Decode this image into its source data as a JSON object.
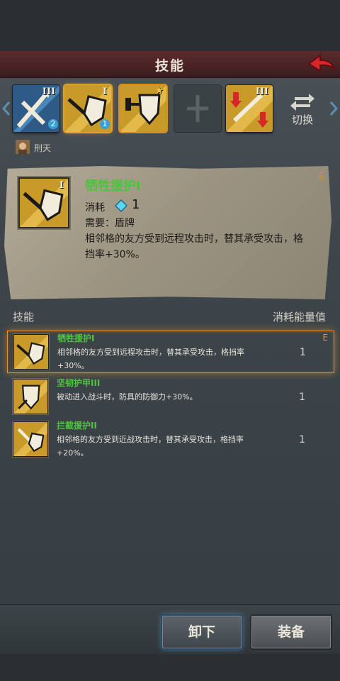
{
  "header": {
    "title": "技能"
  },
  "skill_slots": [
    {
      "tier": "III",
      "badge": "2",
      "style": "blue"
    },
    {
      "tier": "I",
      "badge": "1",
      "style": "gold",
      "selected": true
    },
    {
      "tier": "",
      "badge": "★",
      "style": "gold-shield"
    },
    {
      "tier": "",
      "badge": "",
      "style": "empty"
    },
    {
      "tier": "III",
      "badge": "",
      "style": "gold-arrows"
    }
  ],
  "switch": {
    "label": "切换"
  },
  "hero": {
    "name": "刑天"
  },
  "detail": {
    "title": "牺牲援护I",
    "grade": "E",
    "tier": "I",
    "cost_label": "消耗",
    "cost_value": "1",
    "requirement": "需要：盾牌",
    "description": "相邻格的友方受到远程攻击时，替其承受攻击，格挡率+30%。"
  },
  "list": {
    "header_left": "技能",
    "header_right": "消耗能量值",
    "items": [
      {
        "name": "牺牲援护I",
        "desc": "相邻格的友方受到远程攻击时，替其承受攻击，格挡率+30%。",
        "cost": "1",
        "grade": "E"
      },
      {
        "name": "坚韧护甲III",
        "desc": "被动进入战斗时，防具的防御力+30%。",
        "cost": "1",
        "grade": ""
      },
      {
        "name": "拦截援护II",
        "desc": "相邻格的友方受到近战攻击时，替其承受攻击，格挡率+20%。",
        "cost": "1",
        "grade": ""
      }
    ]
  },
  "buttons": {
    "unequip": "卸下",
    "equip": "装备"
  },
  "colors": {
    "accent_green": "#4fc33d",
    "selected_orange": "#e0952a",
    "title_red": "#4a2326"
  }
}
